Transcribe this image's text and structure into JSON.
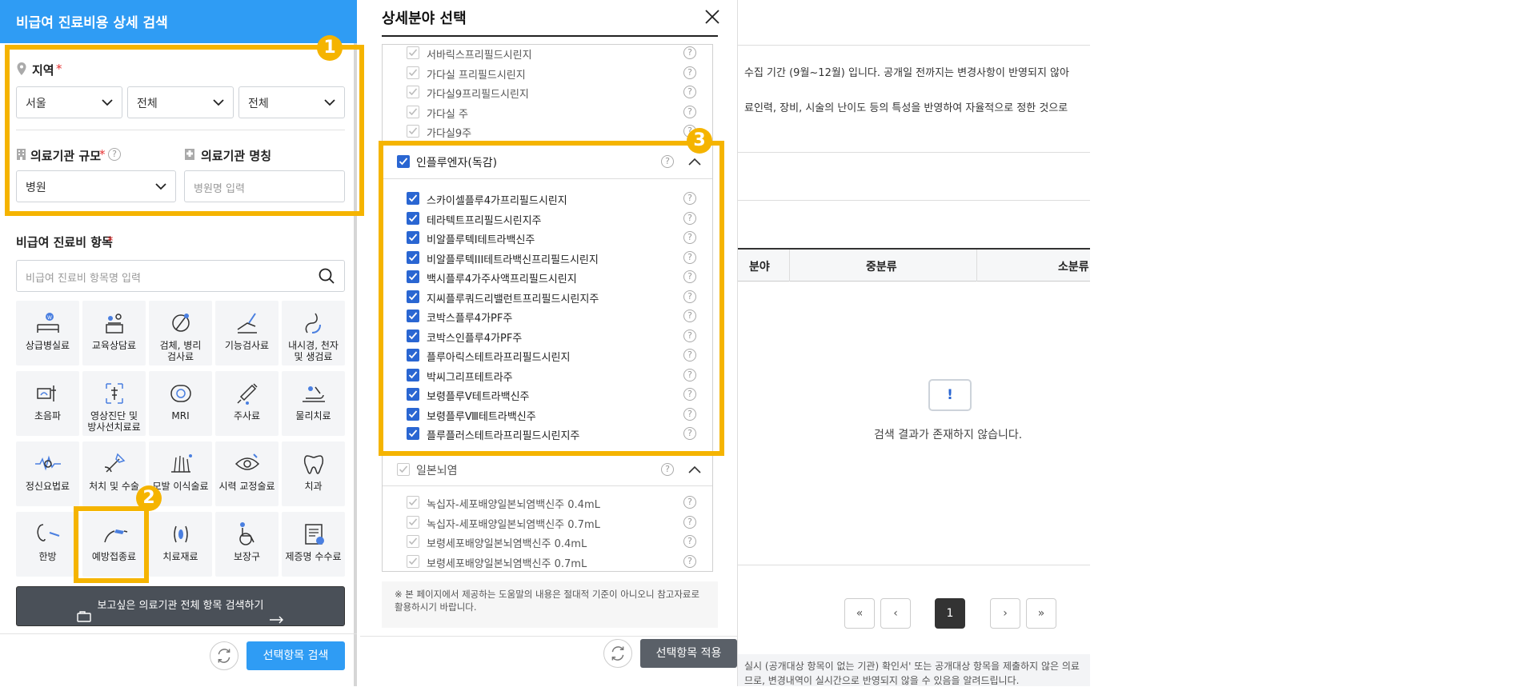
{
  "left_panel": {
    "title": "비급여 진료비용 상세 검색",
    "region_label": "지역",
    "required_mark": "*",
    "region_values": [
      "서울",
      "전체",
      "전체"
    ],
    "hosp_scale_label": "의료기관 규모",
    "hosp_scale_value": "병원",
    "hosp_name_label": "의료기관 명칭",
    "hosp_name_placeholder": "병원명 입력",
    "items_label": "비급여 진료비 항목",
    "items_search_placeholder": "비급여 진료비 항목명 입력",
    "tiles": [
      {
        "label": "상급병실료",
        "icon": "bed-icon"
      },
      {
        "label": "교육상담료",
        "icon": "counsel-icon"
      },
      {
        "label": "검체, 병리\n검사료",
        "icon": "microscope-icon"
      },
      {
        "label": "기능검사료",
        "icon": "hand-test-icon"
      },
      {
        "label": "내시경, 천자\n및 생검료",
        "icon": "endoscope-icon"
      },
      {
        "label": "초음파",
        "icon": "ultrasound-icon"
      },
      {
        "label": "영상진단 및\n방사선치료료",
        "icon": "xray-icon"
      },
      {
        "label": "MRI",
        "icon": "mri-icon"
      },
      {
        "label": "주사료",
        "icon": "syringe-icon"
      },
      {
        "label": "물리치료",
        "icon": "physio-icon"
      },
      {
        "label": "정신요법료",
        "icon": "brainwave-icon"
      },
      {
        "label": "처치 및 수술",
        "icon": "surgery-icon"
      },
      {
        "label": "모발 이식술료",
        "icon": "hair-icon"
      },
      {
        "label": "시력 교정술료",
        "icon": "eye-icon"
      },
      {
        "label": "치과",
        "icon": "tooth-icon"
      },
      {
        "label": "한방",
        "icon": "acupuncture-icon"
      },
      {
        "label": "예방접종료",
        "icon": "vaccine-icon"
      },
      {
        "label": "치료재료",
        "icon": "material-icon"
      },
      {
        "label": "보장구",
        "icon": "wheelchair-icon"
      },
      {
        "label": "제증명 수수료",
        "icon": "certificate-icon"
      }
    ],
    "search_all_button": "보고싶은 의료기관 전체 항목 검색하기",
    "search_selected_button": "선택항목 검색"
  },
  "modal": {
    "title": "상세분야 선택",
    "top_items": [
      "서바릭스프리필드시린지",
      "가다실 프리필드시린지",
      "가다실9프리필드시린지",
      "가다실 주",
      "가다실9주"
    ],
    "group1": {
      "label": "인플루엔자(독감)",
      "items": [
        "스카이셀플루4가프리필드시린지",
        "테라텍트프리필드시린지주",
        "비알플루텍I테트라백신주",
        "비알플루텍III테트라백신프리필드시린지",
        "백시플루4가주사액프리필드시린지",
        "지씨플루쿼드리밸런트프리필드시린지주",
        "코박스플루4가PF주",
        "코박스인플루4가PF주",
        "플루아릭스테트라프리필드시린지",
        "박씨그리프테트라주",
        "보령플루Ⅴ테트라백신주",
        "보령플루Ⅷ테트라백신주",
        "플루플러스테트라프리필드시린지주"
      ]
    },
    "group2": {
      "label": "일본뇌염",
      "items": [
        "녹십자-세포배양일본뇌염백신주 0.4mL",
        "녹십자-세포배양일본뇌염백신주 0.7mL",
        "보령세포배양일본뇌염백신주 0.4mL",
        "보령세포배양일본뇌염백신주 0.7mL"
      ]
    },
    "notice": "※ 본 페이지에서 제공하는 도움말의 내용은 절대적 기준이 아니오니 참고자료로 활용하시기 바랍니다.",
    "apply_button": "선택항목 적용"
  },
  "background": {
    "notice_line1": "수집 기간 (9월~12월) 입니다. 공개일 전까지는 변경사항이 반영되지 않아",
    "notice_line2": "료인력, 장비, 시술의 난이도 등의 특성을 반영하여 자율적으로 정한 것으로",
    "col_partial": "분야",
    "col_mid": "중분류",
    "col_small": "소분류",
    "empty_icon": "!",
    "empty_text": "검색 결과가 존재하지 않습니다.",
    "pagination": {
      "current": "1"
    },
    "footer_line1": "실시 (공개대상 항목이 없는 기관) 확인서' 또는 공개대상 항목을 제출하지 않은 의료",
    "footer_line2": "므로, 변경내역이 실시간으로 반영되지 않을 수 있음을 알려드립니다."
  },
  "callouts": [
    "1",
    "2",
    "3"
  ],
  "colors": {
    "accent": "#2f9cf4",
    "highlight": "#f5b400",
    "check": "#2a66d2",
    "dark_button": "#4a5058"
  }
}
